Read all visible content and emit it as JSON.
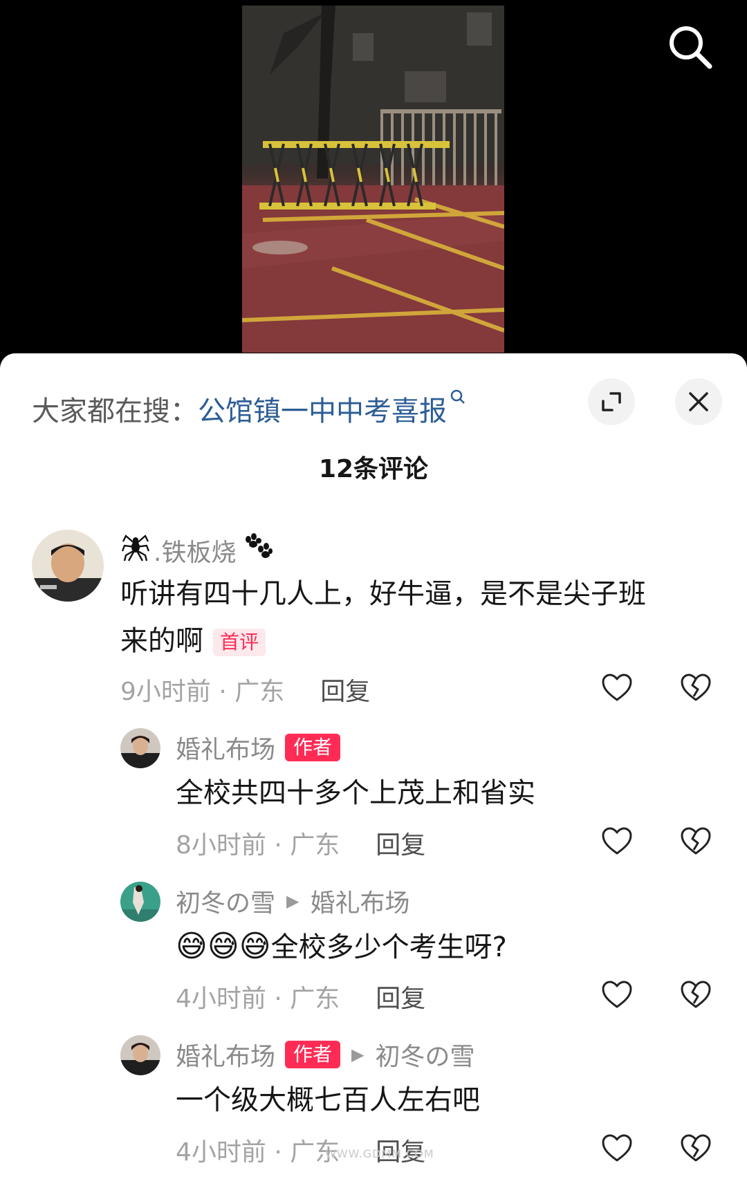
{
  "top": {
    "search_icon": "search-icon"
  },
  "sheet": {
    "hot_search_prefix": "大家都在搜：",
    "hot_search_query": "公馆镇一中中考喜报",
    "hot_search_icon": "magnifier-small-icon",
    "expand_icon": "expand-icon",
    "close_icon": "close-icon",
    "comment_count": "12条评论"
  },
  "comments": [
    {
      "username": ".铁板烧",
      "username_prefix_icon": "spider-icon",
      "username_suffix_icon": "paw-icon",
      "line1": "听讲有四十几人上，好牛逼，是不是尖子班",
      "line2": "来的啊",
      "badge": "首评",
      "time_location": "9小时前 · 广东",
      "reply": "回复"
    },
    {
      "username": "婚礼布场",
      "badge": "作者",
      "text": "全校共四十多个上茂上和省实",
      "time_location": "8小时前 · 广东",
      "reply": "回复"
    },
    {
      "username": "初冬の雪",
      "reply_to": "婚礼布场",
      "emoji": "😅",
      "text": "全校多少个考生呀?",
      "time_location": "4小时前 · 广东",
      "reply": "回复"
    },
    {
      "username": "婚礼布场",
      "badge": "作者",
      "reply_to": "初冬の雪",
      "text": "一个级大概七百人左右吧",
      "time_location": "4小时前 · 广东",
      "reply": "回复"
    }
  ],
  "watermark": "WWW.GDMM.COM",
  "colors": {
    "accent": "#fe2c55",
    "link": "#2c5d96"
  }
}
